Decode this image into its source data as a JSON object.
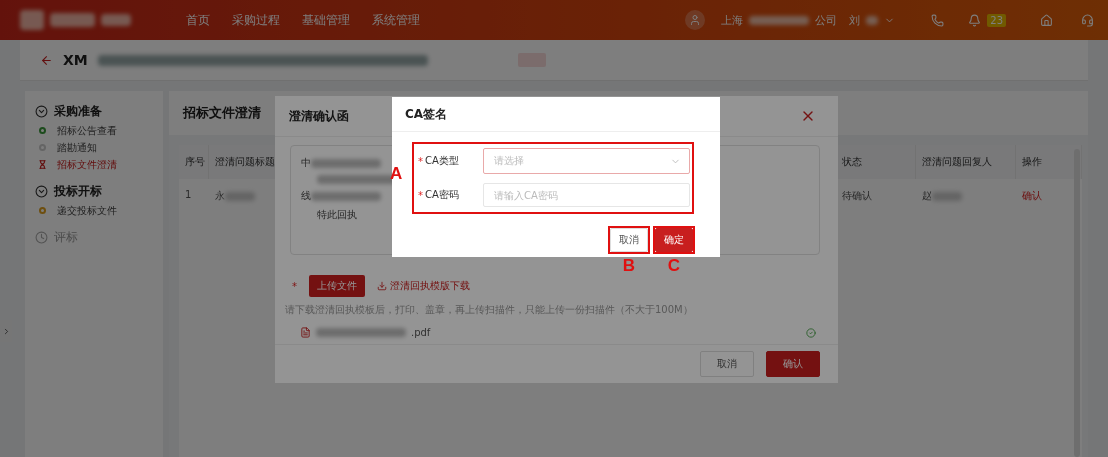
{
  "header": {
    "nav": [
      {
        "label": "首页",
        "selected": false
      },
      {
        "label": "采购过程",
        "selected": false
      },
      {
        "label": "基础管理",
        "selected": false
      },
      {
        "label": "系统管理",
        "selected": false
      }
    ],
    "company_prefix": "上海",
    "company_suffix": "公司",
    "user": "刘",
    "badge": "23"
  },
  "project": {
    "code": "XM"
  },
  "sidebar": {
    "groups": [
      {
        "title": "采购准备",
        "expanded": true,
        "children": [
          {
            "label": "招标公告查看",
            "selected": false,
            "color": "#1d4c1d"
          },
          {
            "label": "踏勘通知",
            "selected": false,
            "color": "#656565"
          },
          {
            "label": "招标文件澄清",
            "selected": true,
            "color": "#631010"
          }
        ]
      },
      {
        "title": "投标开标",
        "expanded": true,
        "children": [
          {
            "label": "递交投标文件",
            "selected": false,
            "color": "#6e4f10"
          }
        ]
      },
      {
        "title": "评标",
        "expanded": false
      }
    ]
  },
  "content": {
    "title": "招标文件澄清",
    "table": {
      "columns": [
        "序号",
        "澄清问题标题",
        "状态",
        "澄清问题回复人",
        "操作"
      ],
      "rows": [
        {
          "cells": [
            {
              "text": "1",
              "redacted": false,
              "kind": "text"
            },
            {
              "text": "永",
              "redacted": true,
              "kind": "text"
            },
            {
              "text": "待确认",
              "redacted": false,
              "kind": "text"
            },
            {
              "text": "赵",
              "redacted": true,
              "kind": "text"
            },
            {
              "text": "确认",
              "redacted": false,
              "kind": "link"
            }
          ]
        }
      ]
    }
  },
  "modal": {
    "title": "澄清确认函",
    "letter": [
      "中",
      "线"
    ],
    "closing": "特此回执",
    "upload_mark": "*",
    "upload_button": "上传文件",
    "download_link": "澄清回执模版下载",
    "hint": "请下载澄清回执模板后，打印、盖章，再上传扫描件，只能上传一份扫描件（不大于100M）",
    "file": ".pdf",
    "buttons": [
      {
        "label": "取消",
        "kind": "secondary"
      },
      {
        "label": "确认",
        "kind": "primary"
      }
    ]
  },
  "ca_dialog": {
    "title": "CA签名",
    "annotation": "A",
    "fields": [
      {
        "label": "CA类型",
        "kind": "select",
        "placeholder": "请选择",
        "mark": "*"
      },
      {
        "label": "CA密码",
        "kind": "password",
        "placeholder": "请输入CA密码",
        "mark": "*"
      }
    ],
    "buttons": [
      {
        "label": "取消",
        "kind": "secondary",
        "annotation": "B"
      },
      {
        "label": "确定",
        "kind": "primary",
        "annotation": "C"
      }
    ]
  }
}
